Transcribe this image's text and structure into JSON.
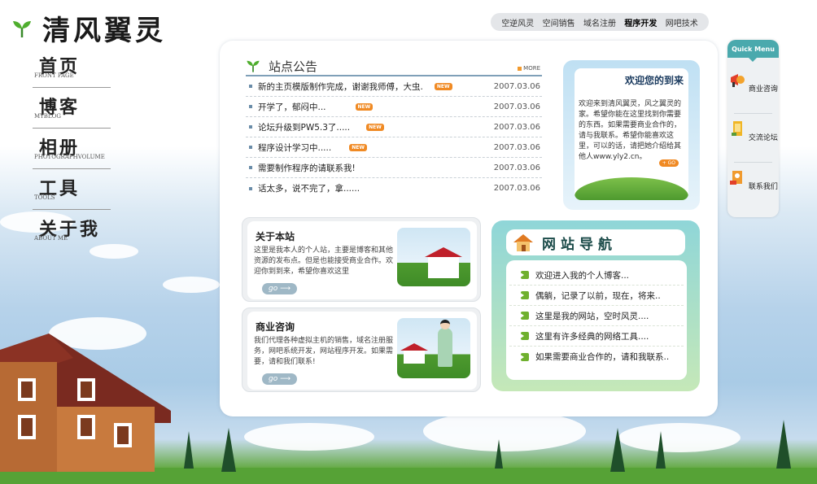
{
  "site": {
    "logo_text": "清风翼灵"
  },
  "topnav": [
    {
      "label": "空逆风灵",
      "current": false
    },
    {
      "label": "空间销售",
      "current": false
    },
    {
      "label": "域名注册",
      "current": false
    },
    {
      "label": "程序开发",
      "current": true
    },
    {
      "label": "网吧技术",
      "current": false
    }
  ],
  "leftnav": [
    {
      "zh": "首页",
      "en": "FRONT PAGE"
    },
    {
      "zh": "博客",
      "en": "MYBLOG"
    },
    {
      "zh": "相册",
      "en": "PHOTOGRAPHVOLUME"
    },
    {
      "zh": "工具",
      "en": "TOOLS"
    },
    {
      "zh": "关于我",
      "en": "ABOUT ME"
    }
  ],
  "notice": {
    "title": "站点公告",
    "more": "MORE",
    "new_badge": "NEW",
    "items": [
      {
        "text": "新的主页模版制作完成，谢谢我师傅，大虫.",
        "date": "2007.03.06",
        "is_new": true
      },
      {
        "text": "开学了，郁闷中...",
        "date": "2007.03.06",
        "is_new": true
      },
      {
        "text": "论坛升级到PW5.3了.....",
        "date": "2007.03.06",
        "is_new": true
      },
      {
        "text": "程序设计学习中.....",
        "date": "2007.03.06",
        "is_new": true
      },
      {
        "text": "需要制作程序的请联系我!",
        "date": "2007.03.06",
        "is_new": false
      },
      {
        "text": "话太多，说不完了，拿......",
        "date": "2007.03.06",
        "is_new": false
      }
    ]
  },
  "welcome": {
    "title": "欢迎您的到来",
    "text": "欢迎来到清风翼灵，风之翼灵的家。希望你能在这里找到你需要的东西。如果需要商业合作的，请与我联系。希望你能喜欢这里，可以的话，请把她介绍给其他人www.yly2.cn。",
    "go": "+ GO"
  },
  "about": {
    "title": "关于本站",
    "text": "这里是我本人的个人站，主要是博客和其他资源的发布点。但是也能接受商业合作。欢迎你到到来，希望你喜欢这里",
    "go": "go"
  },
  "business": {
    "title": "商业咨询",
    "text": "我们代理各种虚拟主机的销售，域名注册服务，网吧系统开发，网站程序开发。如果需要，请和我们联系!",
    "go": "go"
  },
  "sitenav": {
    "title": "网站导航",
    "items": [
      "欢迎进入我的个人博客...",
      "偶躺，记录了以前，现在，将来..",
      "这里是我的网站，空时风灵....",
      "这里有许多经典的网络工具....",
      "如果需要商业合作的，请和我联系.."
    ]
  },
  "quickmenu": {
    "title": "Quick Menu",
    "items": [
      {
        "label": "商业咨询",
        "icon": "megaphone-icon"
      },
      {
        "label": "交流论坛",
        "icon": "folder-icon"
      },
      {
        "label": "联系我们",
        "icon": "contact-icon"
      }
    ]
  },
  "colors": {
    "accent": "#4aa9ad",
    "new_badge": "#f08a24",
    "grass": "#56a236"
  }
}
